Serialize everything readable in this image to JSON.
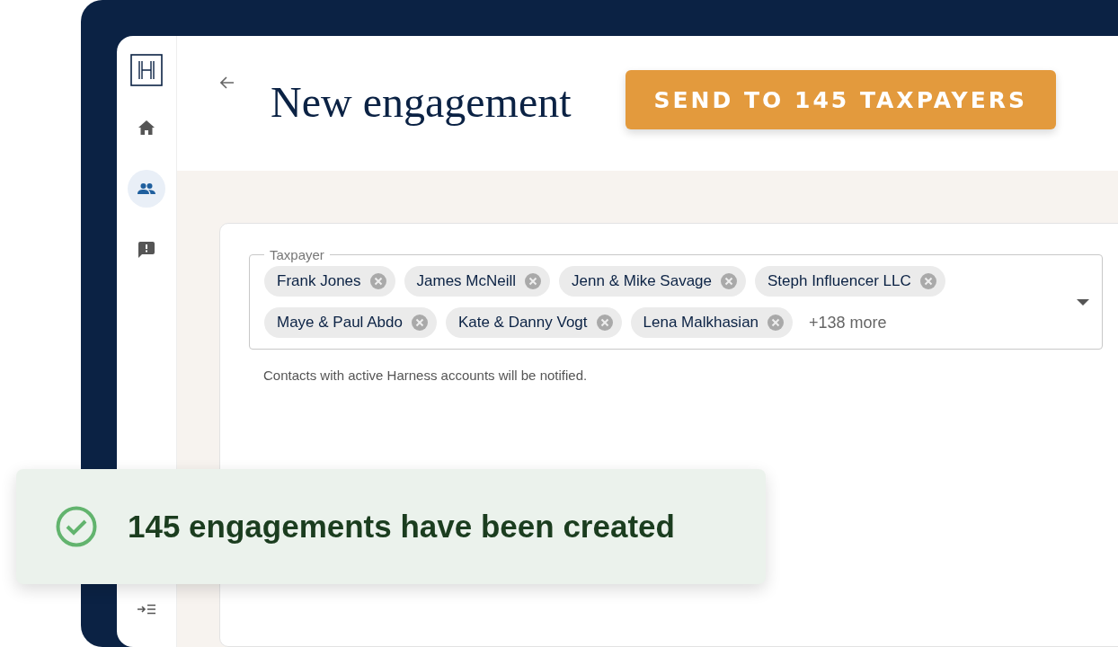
{
  "sidebar": {
    "items": [
      {
        "kind": "home",
        "selected": false
      },
      {
        "kind": "people",
        "selected": true
      },
      {
        "kind": "feedback",
        "selected": false
      }
    ]
  },
  "header": {
    "title": "New engagement",
    "send_button": "SEND TO 145 TAXPAYERS"
  },
  "taxpayer_field": {
    "label": "Taxpayer",
    "chips": [
      "Frank Jones",
      "James McNeill",
      "Jenn & Mike Savage",
      "Steph Influencer LLC",
      "Maye & Paul Abdo",
      "Kate & Danny Vogt",
      "Lena Malkhasian"
    ],
    "more": "+138 more",
    "helper": "Contacts with active Harness accounts will be notified."
  },
  "toast": {
    "message": "145 engagements have been created"
  }
}
